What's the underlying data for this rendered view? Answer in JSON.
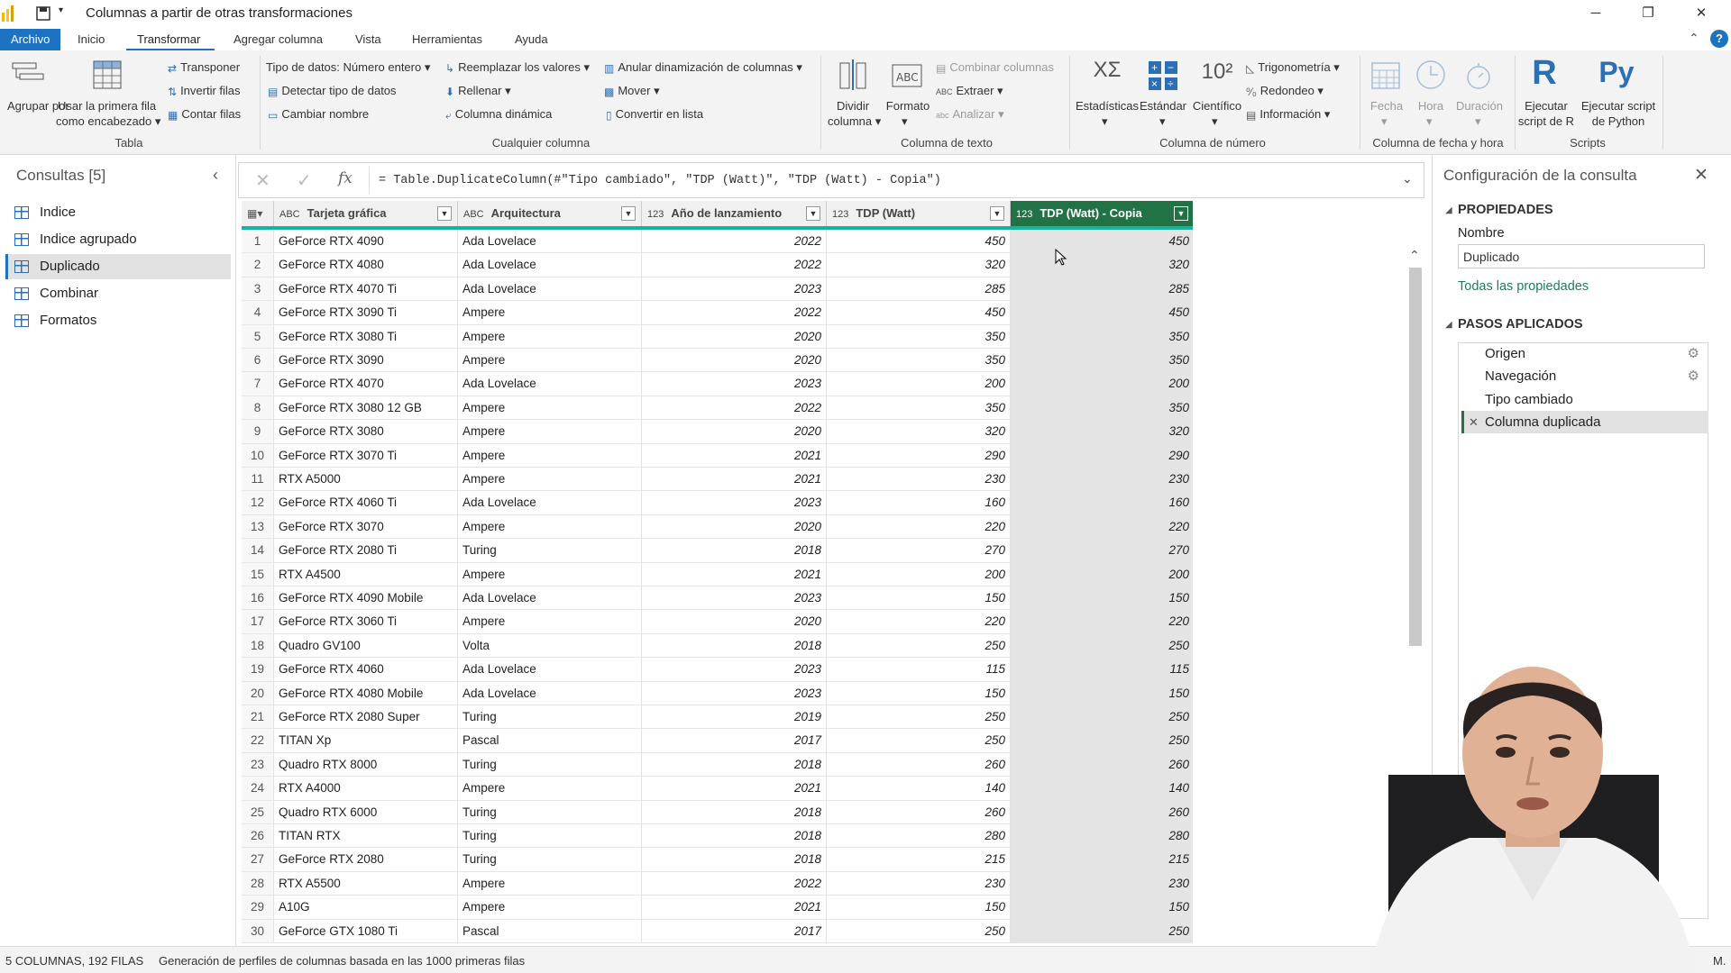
{
  "window": {
    "title": "Columnas a partir de otras transformaciones"
  },
  "menu": {
    "items": [
      "Archivo",
      "Inicio",
      "Transformar",
      "Agregar columna",
      "Vista",
      "Herramientas",
      "Ayuda"
    ]
  },
  "ribbon": {
    "tabla": {
      "agrupar": "Agrupar por",
      "usar_primera": "Usar la primera fila",
      "como_encabezado": "como encabezado",
      "transponer": "Transponer",
      "invertir": "Invertir filas",
      "contar": "Contar filas",
      "group": "Tabla"
    },
    "cualquier": {
      "tipo": "Tipo de datos: Número entero",
      "detectar": "Detectar tipo de datos",
      "cambiar": "Cambiar nombre",
      "reemplazar": "Reemplazar los valores",
      "rellenar": "Rellenar",
      "dinamica": "Columna dinámica",
      "anular": "Anular dinamización de columnas",
      "mover": "Mover",
      "convertir": "Convertir en lista",
      "group": "Cualquier columna"
    },
    "texto": {
      "dividir1": "Dividir",
      "dividir2": "columna",
      "formato": "Formato",
      "combinar": "Combinar columnas",
      "extraer": "Extraer",
      "analizar": "Analizar",
      "group": "Columna de texto"
    },
    "numero": {
      "estadisticas": "Estadísticas",
      "estandar": "Estándar",
      "cientifico": "Científico",
      "trig": "Trigonometría",
      "redondeo": "Redondeo",
      "informacion": "Información",
      "group": "Columna de número"
    },
    "fecha": {
      "fecha": "Fecha",
      "hora": "Hora",
      "duracion": "Duración",
      "group": "Columna de fecha y hora"
    },
    "scripts": {
      "r1": "Ejecutar",
      "r2": "script de R",
      "py1": "Ejecutar script",
      "py2": "de Python",
      "group": "Scripts"
    }
  },
  "queries": {
    "title": "Consultas [5]",
    "items": [
      "Indice",
      "Indice agrupado",
      "Duplicado",
      "Combinar",
      "Formatos"
    ],
    "selected": 2
  },
  "formula": "= Table.DuplicateColumn(#\"Tipo cambiado\", \"TDP (Watt)\", \"TDP (Watt) - Copia\")",
  "columns": [
    {
      "type": "ABC",
      "name": "Tarjeta gráfica"
    },
    {
      "type": "ABC",
      "name": "Arquitectura"
    },
    {
      "type": "123",
      "name": "Año de lanzamiento"
    },
    {
      "type": "123",
      "name": "TDP (Watt)"
    },
    {
      "type": "123",
      "name": "TDP (Watt) - Copia"
    }
  ],
  "rows": [
    [
      "GeForce RTX 4090",
      "Ada Lovelace",
      "2022",
      "450",
      "450"
    ],
    [
      "GeForce RTX 4080",
      "Ada Lovelace",
      "2022",
      "320",
      "320"
    ],
    [
      "GeForce RTX 4070 Ti",
      "Ada Lovelace",
      "2023",
      "285",
      "285"
    ],
    [
      "GeForce RTX 3090 Ti",
      "Ampere",
      "2022",
      "450",
      "450"
    ],
    [
      "GeForce RTX 3080 Ti",
      "Ampere",
      "2020",
      "350",
      "350"
    ],
    [
      "GeForce RTX 3090",
      "Ampere",
      "2020",
      "350",
      "350"
    ],
    [
      "GeForce RTX 4070",
      "Ada Lovelace",
      "2023",
      "200",
      "200"
    ],
    [
      "GeForce RTX 3080 12 GB",
      "Ampere",
      "2022",
      "350",
      "350"
    ],
    [
      "GeForce RTX 3080",
      "Ampere",
      "2020",
      "320",
      "320"
    ],
    [
      "GeForce RTX 3070 Ti",
      "Ampere",
      "2021",
      "290",
      "290"
    ],
    [
      "RTX A5000",
      "Ampere",
      "2021",
      "230",
      "230"
    ],
    [
      "GeForce RTX 4060 Ti",
      "Ada Lovelace",
      "2023",
      "160",
      "160"
    ],
    [
      "GeForce RTX 3070",
      "Ampere",
      "2020",
      "220",
      "220"
    ],
    [
      "GeForce RTX 2080 Ti",
      "Turing",
      "2018",
      "270",
      "270"
    ],
    [
      "RTX A4500",
      "Ampere",
      "2021",
      "200",
      "200"
    ],
    [
      "GeForce RTX 4090 Mobile",
      "Ada Lovelace",
      "2023",
      "150",
      "150"
    ],
    [
      "GeForce RTX 3060 Ti",
      "Ampere",
      "2020",
      "220",
      "220"
    ],
    [
      "Quadro GV100",
      "Volta",
      "2018",
      "250",
      "250"
    ],
    [
      "GeForce RTX 4060",
      "Ada Lovelace",
      "2023",
      "115",
      "115"
    ],
    [
      "GeForce RTX 4080 Mobile",
      "Ada Lovelace",
      "2023",
      "150",
      "150"
    ],
    [
      "GeForce RTX 2080 Super",
      "Turing",
      "2019",
      "250",
      "250"
    ],
    [
      "TITAN Xp",
      "Pascal",
      "2017",
      "250",
      "250"
    ],
    [
      "Quadro RTX 8000",
      "Turing",
      "2018",
      "260",
      "260"
    ],
    [
      "RTX A4000",
      "Ampere",
      "2021",
      "140",
      "140"
    ],
    [
      "Quadro RTX 6000",
      "Turing",
      "2018",
      "260",
      "260"
    ],
    [
      "TITAN RTX",
      "Turing",
      "2018",
      "280",
      "280"
    ],
    [
      "GeForce RTX 2080",
      "Turing",
      "2018",
      "215",
      "215"
    ],
    [
      "RTX A5500",
      "Ampere",
      "2022",
      "230",
      "230"
    ],
    [
      "A10G",
      "Ampere",
      "2021",
      "150",
      "150"
    ],
    [
      "GeForce GTX 1080 Ti",
      "Pascal",
      "2017",
      "250",
      "250"
    ]
  ],
  "settings": {
    "title": "Configuración de la consulta",
    "props": "PROPIEDADES",
    "nombre_label": "Nombre",
    "nombre_value": "Duplicado",
    "todas": "Todas las propiedades",
    "pasos": "PASOS APLICADOS",
    "steps": [
      "Origen",
      "Navegación",
      "Tipo cambiado",
      "Columna duplicada"
    ]
  },
  "status": {
    "left": "5 COLUMNAS, 192 FILAS",
    "mid": "Generación de perfiles de columnas basada en las 1000 primeras filas",
    "right": "M."
  },
  "colors": {
    "accent": "#1e72c2",
    "selected_header": "#217346",
    "header_line": "#13b4a7"
  }
}
